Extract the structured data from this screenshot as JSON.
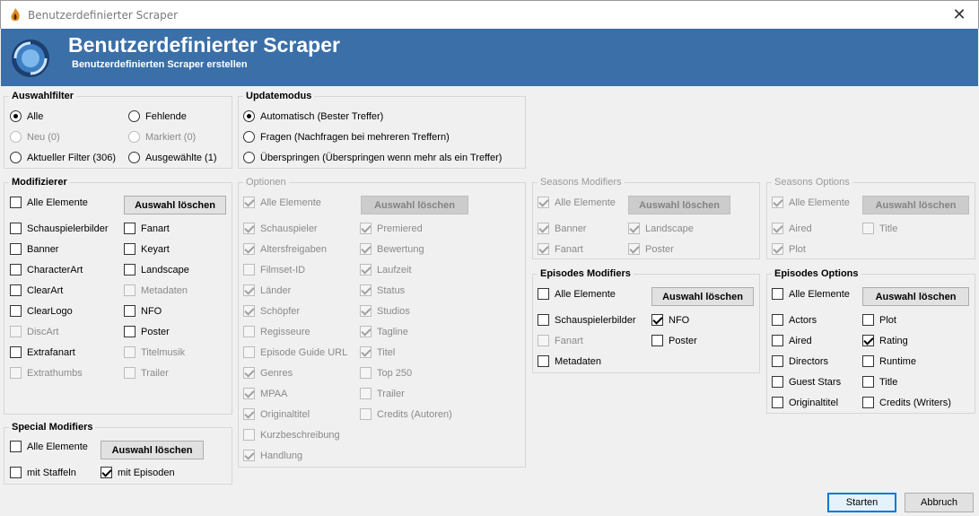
{
  "window": {
    "title": "Benutzerdefinierter Scraper",
    "close_glyph": "✕"
  },
  "banner": {
    "title": "Benutzerdefinierter Scraper",
    "subtitle": "Benutzerdefinierten Scraper erstellen"
  },
  "auswahlfilter": {
    "legend": "Auswahlfilter",
    "options": {
      "alle": "Alle",
      "fehlende": "Fehlende",
      "neu": "Neu (0)",
      "markiert": "Markiert (0)",
      "aktueller": "Aktueller Filter (306)",
      "ausgewaehlte": "Ausgewählte (1)"
    }
  },
  "updatemodus": {
    "legend": "Updatemodus",
    "options": {
      "auto": "Automatisch (Bester Treffer)",
      "fragen": "Fragen (Nachfragen bei mehreren Treffern)",
      "ueber": "Überspringen (Überspringen wenn mehr als ein Treffer)"
    }
  },
  "modifizierer": {
    "legend": "Modifizierer",
    "all": "Alle Elemente",
    "clear": "Auswahl löschen",
    "items": {
      "schauspielerbilder": "Schauspielerbilder",
      "fanart": "Fanart",
      "banner": "Banner",
      "keyart": "Keyart",
      "characterart": "CharacterArt",
      "landscape": "Landscape",
      "clearart": "ClearArt",
      "metadaten": "Metadaten",
      "clearlogo": "ClearLogo",
      "nfo": "NFO",
      "discart": "DiscArt",
      "poster": "Poster",
      "extrafanart": "Extrafanart",
      "titelmusik": "Titelmusik",
      "extrathumbs": "Extrathumbs",
      "trailer": "Trailer"
    }
  },
  "special": {
    "legend": "Special Modifiers",
    "all": "Alle Elemente",
    "clear": "Auswahl löschen",
    "mit_staffeln": "mit Staffeln",
    "mit_episoden": "mit Episoden"
  },
  "optionen": {
    "legend": "Optionen",
    "all": "Alle Elemente",
    "clear": "Auswahl löschen",
    "items": {
      "schauspieler": "Schauspieler",
      "premiered": "Premiered",
      "altersfreigaben": "Altersfreigaben",
      "bewertung": "Bewertung",
      "filmsetid": "Filmset-ID",
      "laufzeit": "Laufzeit",
      "laender": "Länder",
      "status": "Status",
      "schoepfer": "Schöpfer",
      "studios": "Studios",
      "regisseure": "Regisseure",
      "tagline": "Tagline",
      "episodeguide": "Episode Guide URL",
      "titel": "Titel",
      "genres": "Genres",
      "top250": "Top 250",
      "mpaa": "MPAA",
      "trailer": "Trailer",
      "originaltitel": "Originaltitel",
      "credits": "Credits (Autoren)",
      "kurzbeschreibung": "Kurzbeschreibung",
      "handlung": "Handlung"
    }
  },
  "seasons_modifiers": {
    "legend": "Seasons Modifiers",
    "all": "Alle Elemente",
    "clear": "Auswahl löschen",
    "items": {
      "banner": "Banner",
      "landscape": "Landscape",
      "fanart": "Fanart",
      "poster": "Poster"
    }
  },
  "seasons_options": {
    "legend": "Seasons Options",
    "all": "Alle Elemente",
    "clear": "Auswahl löschen",
    "items": {
      "aired": "Aired",
      "title": "Title",
      "plot": "Plot"
    }
  },
  "episodes_modifiers": {
    "legend": "Episodes Modifiers",
    "all": "Alle Elemente",
    "clear": "Auswahl löschen",
    "items": {
      "schauspielerbilder": "Schauspielerbilder",
      "nfo": "NFO",
      "fanart": "Fanart",
      "poster": "Poster",
      "metadaten": "Metadaten"
    }
  },
  "episodes_options": {
    "legend": "Episodes Options",
    "all": "Alle Elemente",
    "clear": "Auswahl löschen",
    "items": {
      "actors": "Actors",
      "plot": "Plot",
      "aired": "Aired",
      "rating": "Rating",
      "directors": "Directors",
      "runtime": "Runtime",
      "gueststars": "Guest Stars",
      "title": "Title",
      "originaltitel": "Originaltitel",
      "credits": "Credits (Writers)"
    }
  },
  "footer": {
    "start": "Starten",
    "cancel": "Abbruch"
  }
}
